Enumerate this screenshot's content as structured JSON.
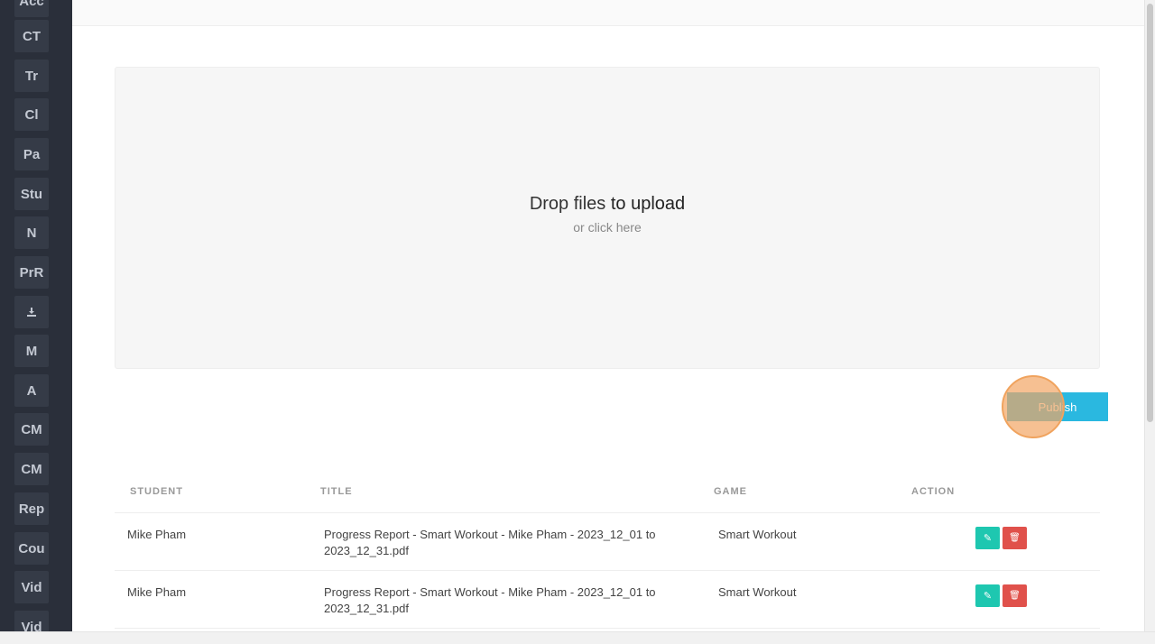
{
  "sidebar": {
    "items": [
      {
        "label": "Acc"
      },
      {
        "label": "CT"
      },
      {
        "label": "Tr"
      },
      {
        "label": "Cl"
      },
      {
        "label": "Pa"
      },
      {
        "label": "Stu"
      },
      {
        "label": "N"
      },
      {
        "label": "PrR"
      },
      {
        "label": "",
        "icon": "download-icon"
      },
      {
        "label": "M"
      },
      {
        "label": "A"
      },
      {
        "label": "CM"
      },
      {
        "label": "CM"
      },
      {
        "label": "Rep"
      },
      {
        "label": "Cou"
      },
      {
        "label": "Vid"
      },
      {
        "label": "Vid"
      }
    ]
  },
  "upload": {
    "title_plain": "Drop files",
    "title_bold": "to upload",
    "subtitle": "or click here"
  },
  "actions": {
    "publish_label": "Publish"
  },
  "table": {
    "headers": {
      "student": "STUDENT",
      "title": "TITLE",
      "game": "GAME",
      "action": "ACTION"
    },
    "rows": [
      {
        "student": "Mike Pham",
        "title": "Progress Report - Smart Workout - Mike Pham - 2023_12_01 to 2023_12_31.pdf",
        "game": "Smart Workout"
      },
      {
        "student": "Mike Pham",
        "title": "Progress Report - Smart Workout - Mike Pham - 2023_12_01 to 2023_12_31.pdf",
        "game": "Smart Workout"
      }
    ]
  },
  "colors": {
    "sidebar_bg": "#2a2f3a",
    "publish_bg": "#2ab8e0",
    "edit_bg": "#1ec7b0",
    "delete_bg": "#e0514b"
  }
}
